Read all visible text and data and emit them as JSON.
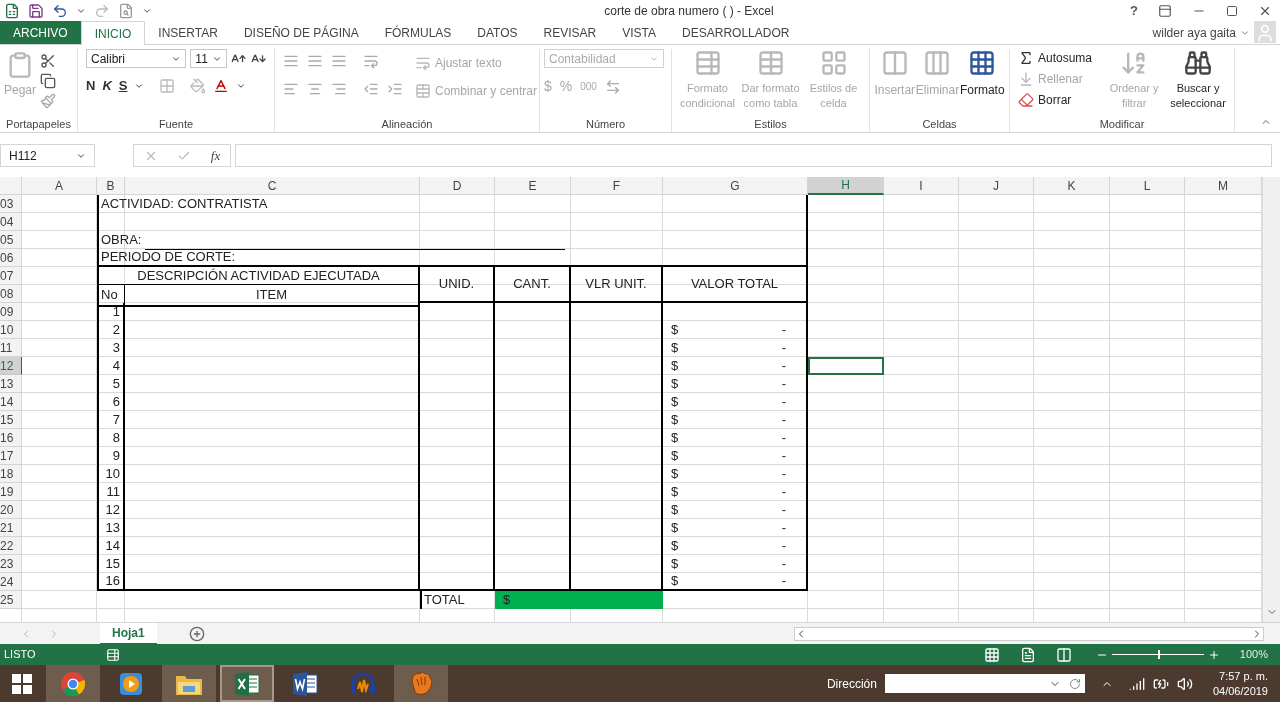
{
  "window": {
    "title": "corte de obra numero (  ) - Excel",
    "help": "?"
  },
  "ribbon_tabs": [
    {
      "label": "ARCHIVO",
      "selected": false
    },
    {
      "label": "INICIO",
      "selected": true
    },
    {
      "label": "INSERTAR",
      "selected": false
    },
    {
      "label": "DISEÑO DE PÁGINA",
      "selected": false
    },
    {
      "label": "FÓRMULAS",
      "selected": false
    },
    {
      "label": "DATOS",
      "selected": false
    },
    {
      "label": "REVISAR",
      "selected": false
    },
    {
      "label": "VISTA",
      "selected": false
    },
    {
      "label": "DESARROLLADOR",
      "selected": false
    }
  ],
  "user": "wilder aya gaita",
  "ribbon": {
    "groups": [
      {
        "name": "Portapapeles",
        "buttons": [
          {
            "label": "Pegar",
            "disabled": true
          }
        ]
      },
      {
        "name": "Fuente",
        "font": "Calibri",
        "size": "11",
        "styles": [
          "N",
          "K",
          "S"
        ]
      },
      {
        "name": "Alineación",
        "buttons": [
          {
            "label": "Ajustar texto",
            "disabled": true
          },
          {
            "label": "Combinar y centrar",
            "disabled": true
          }
        ]
      },
      {
        "name": "Número",
        "format": "Contabilidad",
        "symbols": [
          "$",
          "%",
          "000"
        ]
      },
      {
        "name": "Estilos",
        "buttons": [
          {
            "label": "Formato condicional",
            "disabled": true
          },
          {
            "label": "Dar formato como tabla",
            "disabled": true
          },
          {
            "label": "Estilos de celda",
            "disabled": true
          }
        ]
      },
      {
        "name": "Celdas",
        "buttons": [
          {
            "label": "Insertar",
            "disabled": true
          },
          {
            "label": "Eliminar",
            "disabled": true
          },
          {
            "label": "Formato",
            "disabled": false
          }
        ]
      },
      {
        "name": "Modificar",
        "buttons": [
          {
            "label": "Autosuma",
            "disabled": false
          },
          {
            "label": "Rellenar",
            "disabled": true
          },
          {
            "label": "Borrar",
            "disabled": false
          },
          {
            "label": "Ordenar y filtrar",
            "disabled": true
          },
          {
            "label": "Buscar y seleccionar",
            "disabled": false
          }
        ]
      }
    ]
  },
  "formula_bar": {
    "name_box": "H112",
    "fx": "fx"
  },
  "columns": [
    {
      "label": "A",
      "selected": false
    },
    {
      "label": "B",
      "selected": false
    },
    {
      "label": "C",
      "selected": false
    },
    {
      "label": "D",
      "selected": false
    },
    {
      "label": "E",
      "selected": false
    },
    {
      "label": "F",
      "selected": false
    },
    {
      "label": "G",
      "selected": false
    },
    {
      "label": "H",
      "selected": true
    },
    {
      "label": "I",
      "selected": false
    },
    {
      "label": "J",
      "selected": false
    },
    {
      "label": "K",
      "selected": false
    },
    {
      "label": "L",
      "selected": false
    },
    {
      "label": "M",
      "selected": false
    }
  ],
  "rows": [
    {
      "number": "03",
      "selected": false
    },
    {
      "number": "04",
      "selected": false
    },
    {
      "number": "05",
      "selected": false
    },
    {
      "number": "06",
      "selected": false
    },
    {
      "number": "07",
      "selected": false
    },
    {
      "number": "08",
      "selected": false
    },
    {
      "number": "09",
      "selected": false
    },
    {
      "number": "10",
      "selected": false
    },
    {
      "number": "11",
      "selected": false
    },
    {
      "number": "12",
      "selected": true
    },
    {
      "number": "13",
      "selected": false
    },
    {
      "number": "14",
      "selected": false
    },
    {
      "number": "15",
      "selected": false
    },
    {
      "number": "16",
      "selected": false
    },
    {
      "number": "17",
      "selected": false
    },
    {
      "number": "18",
      "selected": false
    },
    {
      "number": "19",
      "selected": false
    },
    {
      "number": "20",
      "selected": false
    },
    {
      "number": "21",
      "selected": false
    },
    {
      "number": "22",
      "selected": false
    },
    {
      "number": "23",
      "selected": false
    },
    {
      "number": "24",
      "selected": false
    },
    {
      "number": "25",
      "selected": false
    }
  ],
  "form": {
    "activity": "ACTIVIDAD: CONTRATISTA",
    "obra_label": "OBRA:",
    "periodo_label": "PERIODO DE CORTE:",
    "header_description": "DESCRIPCIÓN ACTIVIDAD EJECUTADA",
    "header_no": "No",
    "header_item": "ITEM",
    "header_unid": "UNID.",
    "header_cant": "CANT.",
    "header_vlr_unit": "VLR UNIT.",
    "header_valor_total": "VALOR TOTAL",
    "items": [
      {
        "no": "1"
      },
      {
        "no": "2",
        "currency": "$",
        "value": "-"
      },
      {
        "no": "3",
        "currency": "$",
        "value": "-"
      },
      {
        "no": "4",
        "currency": "$",
        "value": "-"
      },
      {
        "no": "5",
        "currency": "$",
        "value": "-"
      },
      {
        "no": "6",
        "currency": "$",
        "value": "-"
      },
      {
        "no": "7",
        "currency": "$",
        "value": "-"
      },
      {
        "no": "8",
        "currency": "$",
        "value": "-"
      },
      {
        "no": "9",
        "currency": "$",
        "value": "-"
      },
      {
        "no": "10",
        "currency": "$",
        "value": "-"
      },
      {
        "no": "11",
        "currency": "$",
        "value": "-"
      },
      {
        "no": "12",
        "currency": "$",
        "value": "-"
      },
      {
        "no": "13",
        "currency": "$",
        "value": "-"
      },
      {
        "no": "14",
        "currency": "$",
        "value": "-"
      },
      {
        "no": "15",
        "currency": "$",
        "value": "-"
      },
      {
        "no": "16",
        "currency": "$",
        "value": "-"
      }
    ],
    "total_label": "TOTAL",
    "total_currency": "$"
  },
  "sheet_tabs": [
    {
      "label": "Hoja1",
      "selected": true
    }
  ],
  "status_bar": {
    "status": "LISTO",
    "zoom": "100%",
    "level": 0.5
  },
  "taskbar": {
    "apps": [
      {
        "kind": "browser",
        "running": true,
        "selected": false
      },
      {
        "kind": "media",
        "running": false,
        "selected": false
      },
      {
        "kind": "folder",
        "running": true,
        "selected": false
      },
      {
        "kind": "excel",
        "running": true,
        "selected": true
      },
      {
        "kind": "word",
        "running": false,
        "selected": false
      },
      {
        "kind": "audio",
        "running": false,
        "selected": false
      },
      {
        "kind": "glove",
        "running": true,
        "selected": false
      }
    ],
    "address_label": "Dirección",
    "time": "7:57 p. m.",
    "date": "04/06/2019"
  }
}
